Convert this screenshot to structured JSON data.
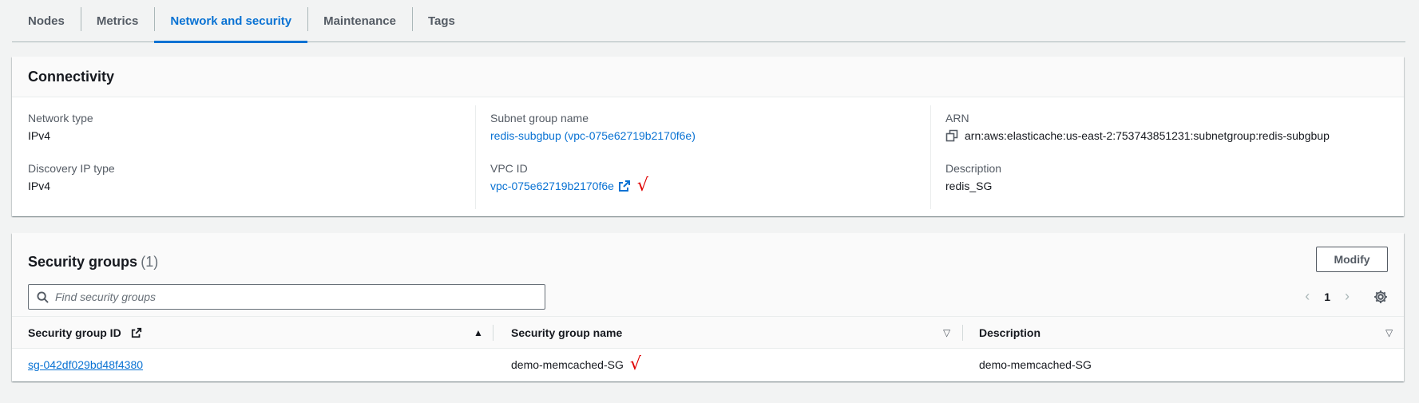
{
  "tabs": [
    {
      "label": "Nodes",
      "active": false
    },
    {
      "label": "Metrics",
      "active": false
    },
    {
      "label": "Network and security",
      "active": true
    },
    {
      "label": "Maintenance",
      "active": false
    },
    {
      "label": "Tags",
      "active": false
    }
  ],
  "connectivity": {
    "title": "Connectivity",
    "network_type_label": "Network type",
    "network_type_value": "IPv4",
    "discovery_ip_label": "Discovery IP type",
    "discovery_ip_value": "IPv4",
    "subnet_group_label": "Subnet group name",
    "subnet_group_value": "redis-subgbup (vpc-075e62719b2170f6e)",
    "vpc_id_label": "VPC ID",
    "vpc_id_value": "vpc-075e62719b2170f6e",
    "vpc_check_mark": "√",
    "arn_label": "ARN",
    "arn_value": "arn:aws:elasticache:us-east-2:753743851231:subnetgroup:redis-subgbup",
    "description_label": "Description",
    "description_value": "redis_SG"
  },
  "security_groups": {
    "title": "Security groups",
    "count": "(1)",
    "modify_label": "Modify",
    "search_placeholder": "Find security groups",
    "page_number": "1",
    "columns": {
      "id": "Security group ID",
      "name": "Security group name",
      "description": "Description"
    },
    "rows": [
      {
        "id": "sg-042df029bd48f4380",
        "name": "demo-memcached-SG",
        "check_mark": "√",
        "description": "demo-memcached-SG"
      }
    ]
  },
  "colors": {
    "link": "#0972d3",
    "annotation": "#e00000",
    "background": "#f2f3f3"
  }
}
